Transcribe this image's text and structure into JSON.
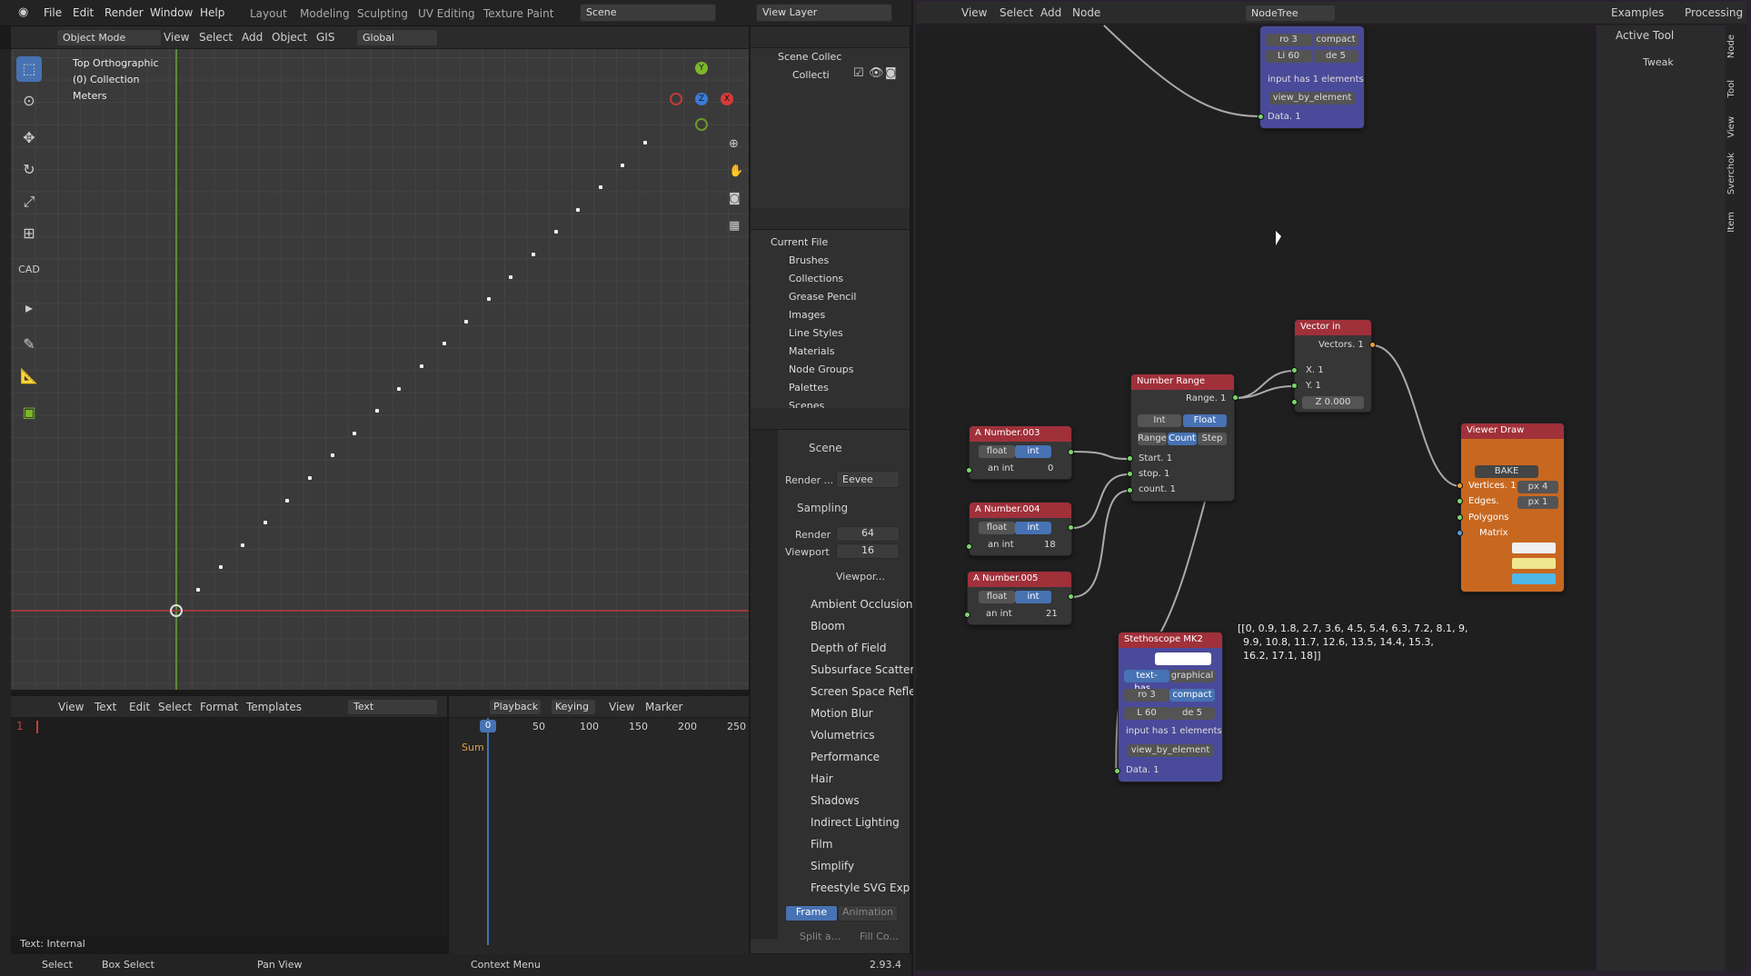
{
  "app": {
    "menus": [
      "File",
      "Edit",
      "Render",
      "Window",
      "Help"
    ],
    "workspaces": [
      "Layout",
      "Modeling",
      "Sculpting",
      "UV Editing",
      "Texture Paint"
    ],
    "scene": "Scene",
    "view_layer": "View Layer"
  },
  "viewport": {
    "mode": "Object Mode",
    "menus": [
      "View",
      "Select",
      "Add",
      "Object",
      "GIS"
    ],
    "orientation": "Global",
    "overlay_title": "Top Orthographic",
    "overlay_collection": "(0) Collection",
    "overlay_units": "Meters",
    "cad_label": "CAD"
  },
  "outliner_top": {
    "rows": [
      "Scene Collec",
      "Collecti"
    ]
  },
  "outliner_file": {
    "root": "Current File",
    "items": [
      "Brushes",
      "Collections",
      "Grease Pencil",
      "Images",
      "Line Styles",
      "Materials",
      "Node Groups",
      "Palettes",
      "Scenes"
    ]
  },
  "properties": {
    "scene_label": "Scene",
    "render_engine_label": "Render ...",
    "render_engine": "Eevee",
    "sampling": "Sampling",
    "render_label": "Render",
    "render_value": "64",
    "viewport_label": "Viewport",
    "viewport_value": "16",
    "viewport_denoise": "Viewpor...",
    "sections": [
      "Ambient Occlusion",
      "Bloom",
      "Depth of Field",
      "Subsurface Scattering",
      "Screen Space Refle",
      "Motion Blur",
      "Volumetrics",
      "Performance",
      "Hair",
      "Shadows",
      "Indirect Lighting",
      "Film",
      "Simplify",
      "Freestyle SVG Exp"
    ],
    "frame_tab": "Frame",
    "animation_tab": "Animation",
    "split": "Split a...",
    "fill": "Fill Co..."
  },
  "text_editor": {
    "menus": [
      "View",
      "Text",
      "Edit",
      "Select",
      "Format",
      "Templates"
    ],
    "name": "Text",
    "line": "1",
    "status": "Text: Internal"
  },
  "timeline": {
    "menus": [
      "Playback",
      "Keying",
      "View",
      "Marker"
    ],
    "frame": "0",
    "ticks": [
      "50",
      "100",
      "150",
      "200",
      "250"
    ],
    "summary": "Sum"
  },
  "statusbar": {
    "select": "Select",
    "box_select": "Box Select",
    "pan": "Pan View",
    "context": "Context Menu",
    "version": "2.93.4"
  },
  "node_editor": {
    "menus": [
      "View",
      "Select",
      "Add",
      "Node"
    ],
    "tree": "NodeTree",
    "examples": "Examples",
    "processing": "Processing",
    "active_tool": "Active Tool",
    "tweak": "Tweak",
    "side_tabs": [
      "Node",
      "Tool",
      "View",
      "Sverchok",
      "Item"
    ]
  },
  "nodes": {
    "stetho_top": {
      "ro": "ro 3",
      "compact": "compact",
      "li": "Li 60",
      "de": "de 5",
      "info": "input has 1 elements",
      "view": "view_by_element",
      "data": "Data. 1"
    },
    "vector_in": {
      "title": "Vector in",
      "out": "Vectors. 1",
      "x": "X. 1",
      "y": "Y. 1",
      "z": "Z 0.000"
    },
    "number_range": {
      "title": "Number Range",
      "out": "Range. 1",
      "int": "Int",
      "float": "Float",
      "range": "Range",
      "count": "Count",
      "step": "Step",
      "start": "Start. 1",
      "stop": "stop. 1",
      "countin": "count. 1"
    },
    "num003": {
      "title": "A Number.003",
      "float": "float",
      "int": "int",
      "field": "an int",
      "value": "0"
    },
    "num004": {
      "title": "A Number.004",
      "float": "float",
      "int": "int",
      "field": "an int",
      "value": "18"
    },
    "num005": {
      "title": "A Number.005",
      "float": "float",
      "int": "int",
      "field": "an int",
      "value": "21"
    },
    "viewer": {
      "title": "Viewer Draw",
      "bake": "BAKE",
      "vertices": "Vertices. 1",
      "px4": "px 4",
      "edges": "Edges.",
      "px1": "px 1",
      "polygons": "Polygons",
      "matrix": "Matrix"
    },
    "stetho_mk2": {
      "title": "Stethoscope MK2",
      "textbase": "text-bas...",
      "graphical": "graphical",
      "ro": "ro 3",
      "compact": "compact",
      "li": "L 60",
      "de": "de 5",
      "info": "input has 1 elements",
      "view": "view_by_element",
      "data": "Data. 1"
    },
    "output_text": [
      "[[0, 0.9, 1.8, 2.7, 3.6, 4.5, 5.4, 6.3, 7.2, 8.1, 9,",
      "9.9, 10.8, 11.7, 12.6, 13.5, 14.4, 15.3,",
      "16.2, 17.1, 18]]"
    ]
  },
  "colors": {
    "node_header_red": "#a0303a",
    "stetho_body": "#4a4a9a",
    "viewer_body": "#c86820",
    "selected_blue": "#4772b3"
  }
}
